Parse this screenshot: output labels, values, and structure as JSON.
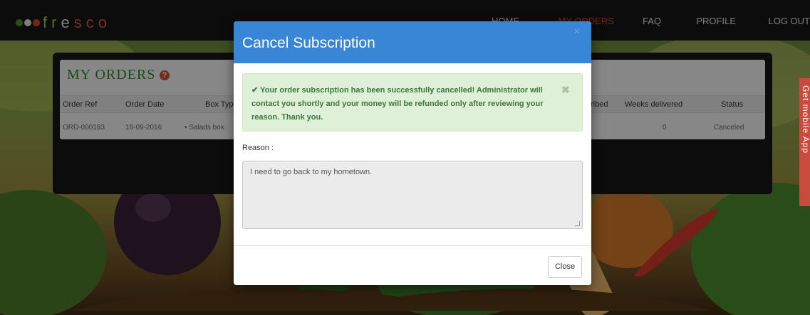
{
  "app": {
    "logo_text_parts": [
      "fr",
      "e",
      "sco"
    ],
    "logo_colors": [
      "#78b843",
      "#e8e8e8",
      "#d9463a"
    ]
  },
  "nav": {
    "items": [
      "HOME",
      "MY ORDERS",
      "FAQ",
      "PROFILE",
      "LOG OUT"
    ],
    "active_color": "#d9463a"
  },
  "orders": {
    "title": "MY ORDERS",
    "help_icon": "?",
    "columns": [
      "Order Ref",
      "Order Date",
      "Box Type",
      "ribed",
      "Weeks delivered",
      "Status"
    ],
    "rows": [
      {
        "order_ref": "ORD-000183",
        "order_date": "18-09-2016",
        "box_type": "• Salads box",
        "subscribed": "",
        "weeks_delivered": "0",
        "status": "Canceled"
      }
    ]
  },
  "side_tab": {
    "label": "Get mobile App"
  },
  "modal": {
    "title": "Cancel Subscription",
    "close_x": "×",
    "alert": {
      "icon": "check-icon",
      "message": "✔ Your order subscription has been successfully cancelled! Administrator will contact you shortly and your money will be refunded only after reviewing your reason. Thank you.",
      "dismiss": "✖"
    },
    "reason_label": "Reason :",
    "reason_value": "I need to go back to my hometown.",
    "close_button": "Close"
  },
  "colors": {
    "header_blue": "#3a86d6",
    "alert_bg": "#dff0d8",
    "alert_text": "#3c763d",
    "title_green": "#2d8a2d",
    "accent_red": "#d24a3b"
  }
}
